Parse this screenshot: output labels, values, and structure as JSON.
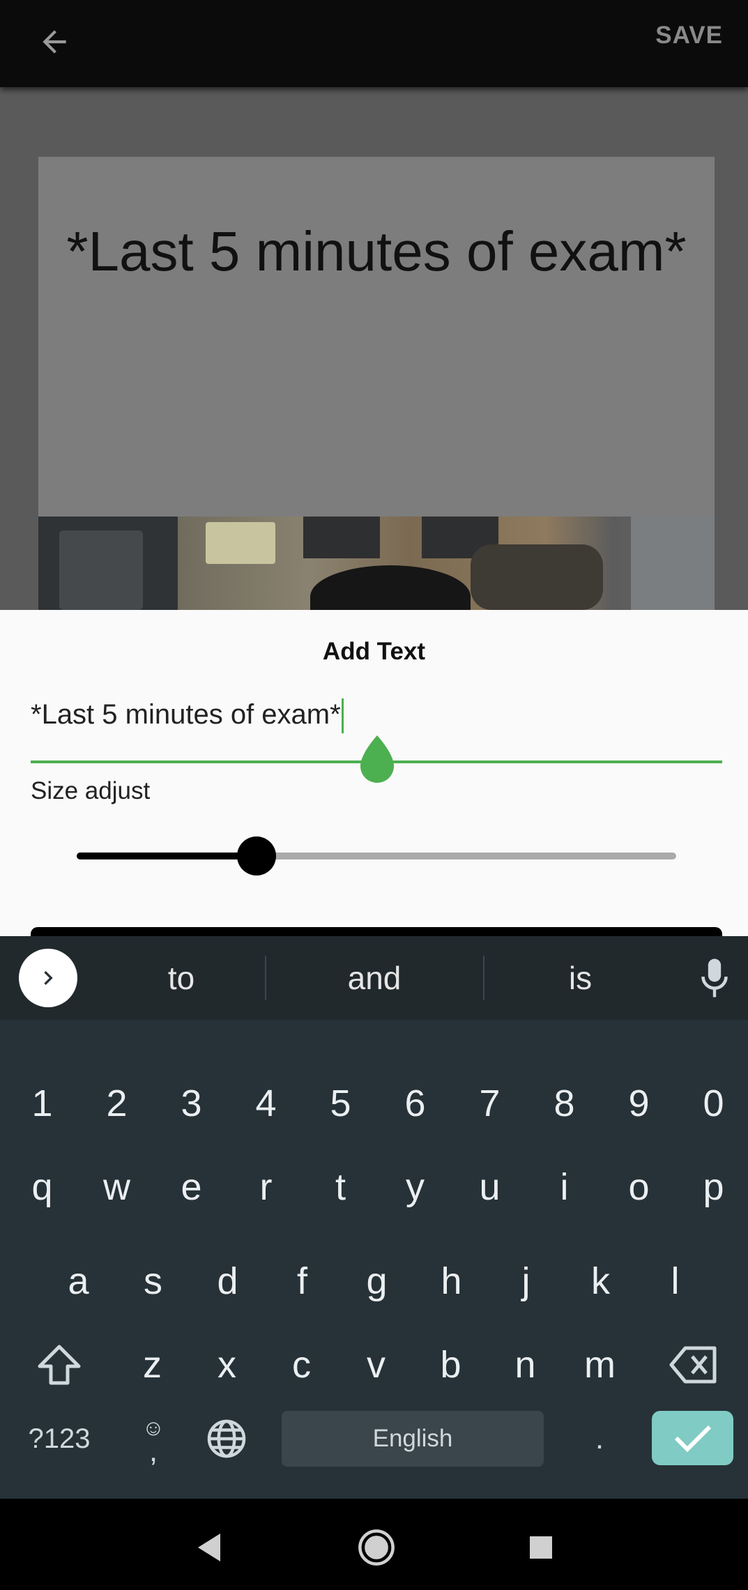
{
  "appbar": {
    "back_icon": "arrow-back-icon",
    "save_label": "SAVE"
  },
  "canvas": {
    "caption": "*Last 5 minutes of exam*"
  },
  "sheet": {
    "title": "Add Text",
    "input_value": "*Last 5 minutes of exam*",
    "size_label": "Size adjust",
    "size_slider_fraction": 0.3,
    "accent_color": "#4caf50"
  },
  "keyboard": {
    "suggestions": [
      "to",
      "and",
      "is"
    ],
    "number_row": [
      "1",
      "2",
      "3",
      "4",
      "5",
      "6",
      "7",
      "8",
      "9",
      "0"
    ],
    "row1": [
      "q",
      "w",
      "e",
      "r",
      "t",
      "y",
      "u",
      "i",
      "o",
      "p"
    ],
    "row2": [
      "a",
      "s",
      "d",
      "f",
      "g",
      "h",
      "j",
      "k",
      "l"
    ],
    "row3": [
      "z",
      "x",
      "c",
      "v",
      "b",
      "n",
      "m"
    ],
    "symbols_label": "?123",
    "emoji_label": "☺",
    "comma_label": ",",
    "space_label": "English",
    "period_label": ".",
    "enter_color": "#80cbc4"
  }
}
